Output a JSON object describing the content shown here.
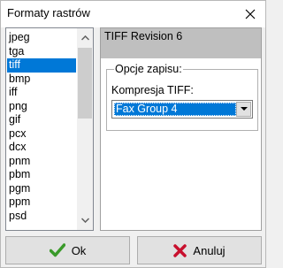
{
  "window": {
    "title": "Formaty rastrów"
  },
  "format_list": {
    "items": [
      "jpeg",
      "tga",
      "tiff",
      "bmp",
      "iff",
      "png",
      "gif",
      "pcx",
      "dcx",
      "pnm",
      "pbm",
      "pgm",
      "ppm",
      "psd"
    ],
    "selected": "tiff"
  },
  "info": {
    "header": "TIFF Revision 6",
    "options_group": "Opcje zapisu:",
    "compression_label": "Kompresja TIFF:",
    "compression_value": "Fax Group 4"
  },
  "buttons": {
    "ok_label": "Ok",
    "cancel_label": "Anuluj"
  },
  "colors": {
    "selection": "#0078d7",
    "ok_check": "#3a9a2a",
    "cancel_x": "#c8102e"
  },
  "icons": {
    "close": "close-icon",
    "ok": "check-icon",
    "cancel": "x-icon"
  }
}
